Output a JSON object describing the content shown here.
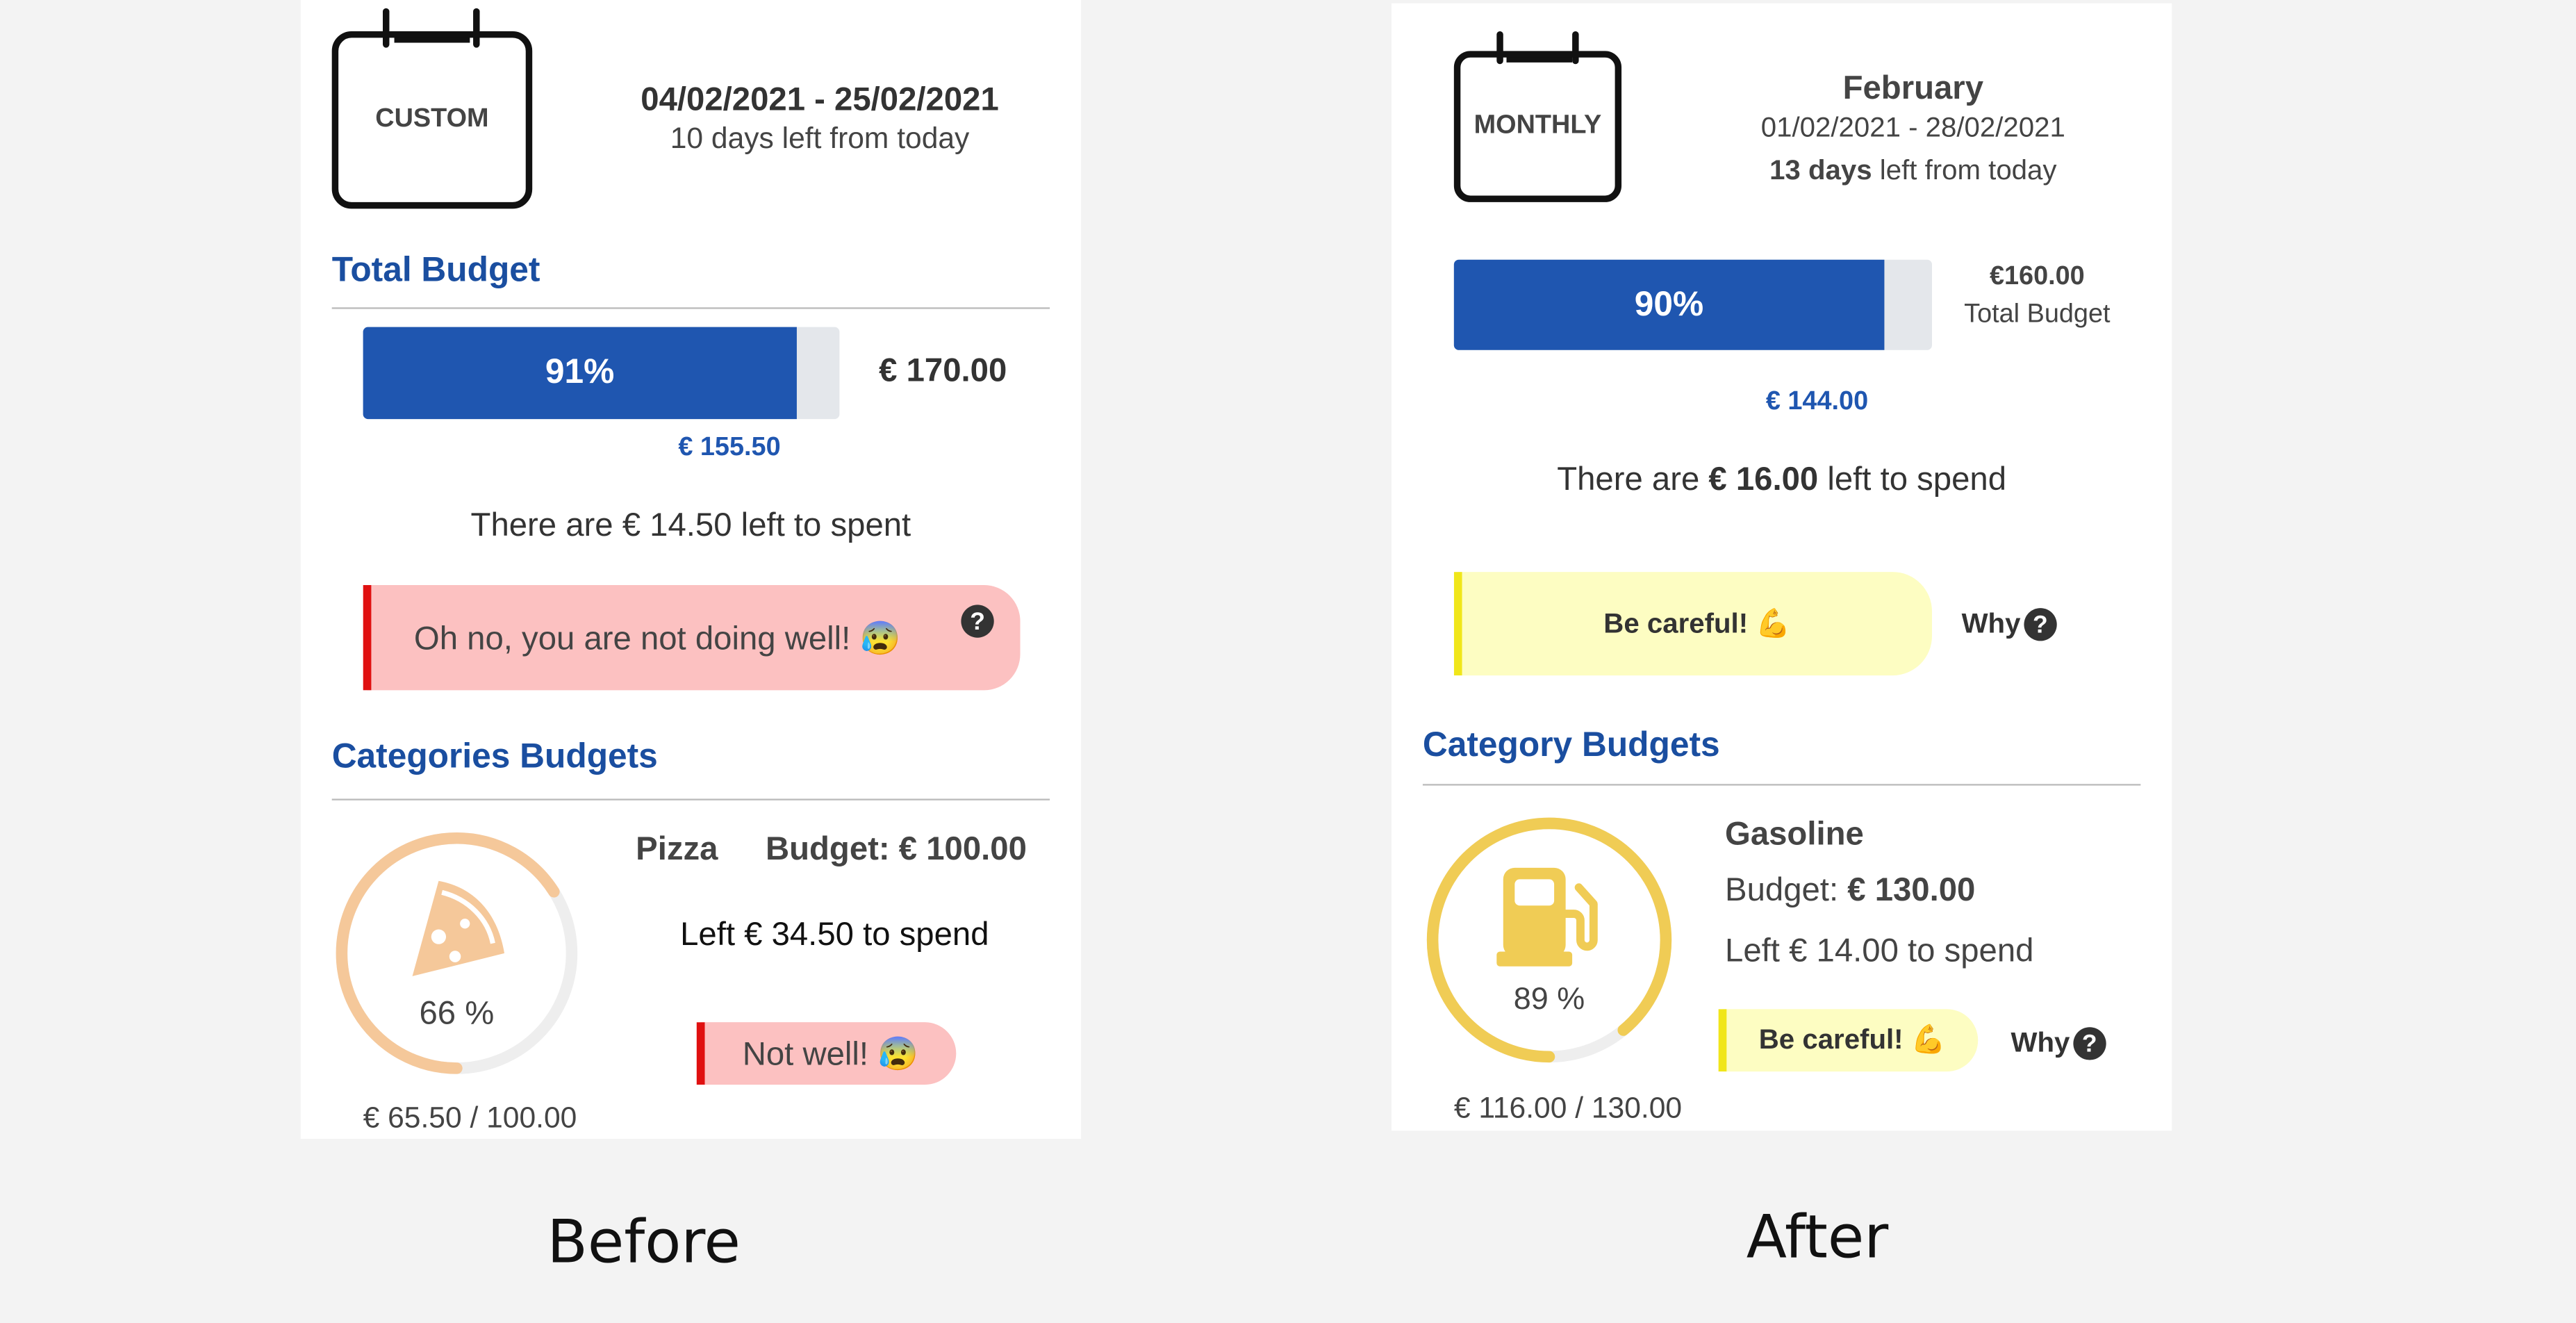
{
  "before": {
    "caption": "Before",
    "period_type": "CUSTOM",
    "date_range": "04/02/2021 - 25/02/2021",
    "days_left": "10 days left from today",
    "total_budget_title": "Total Budget",
    "progress_percent": 91,
    "progress_label": "91%",
    "total_amount": "€ 170.00",
    "spent_amount": "€ 155.50",
    "left_text": "There are € 14.50 left to spent",
    "alert_text": "Oh no, you are not doing well! 😰",
    "help_glyph": "?",
    "categories_title": "Categories Budgets",
    "category": {
      "name": "Pizza",
      "budget_label": "Budget: € 100.00",
      "left_text": "Left € 34.50 to spend",
      "percent": 66,
      "percent_label": "66 %",
      "amount_text": "€ 65.50 / 100.00",
      "status": "Not well! 😰",
      "icon": "pizza-icon",
      "color": "#f5c89a"
    },
    "colors": {
      "accent": "#1f56b0",
      "alert": "#e01010",
      "alert_bg": "#fcc1c1"
    }
  },
  "after": {
    "caption": "After",
    "period_type": "MONTHLY",
    "month": "February",
    "date_range": "01/02/2021 - 28/02/2021",
    "days_left_bold": "13 days",
    "days_left_rest": " left from today",
    "progress_percent": 90,
    "progress_label": "90%",
    "total_amount": "€160.00",
    "total_label": "Total Budget",
    "spent_amount": "€ 144.00",
    "left_prefix": "There are ",
    "left_amount": "€ 16.00",
    "left_suffix": " left to spend",
    "alert_text": "Be careful! 💪",
    "why_label": "Why",
    "help_glyph": "?",
    "categories_title": "Category Budgets",
    "category": {
      "name": "Gasoline",
      "budget_prefix": "Budget: ",
      "budget_amount": "€ 130.00",
      "left_text": "Left € 14.00 to spend",
      "percent": 89,
      "percent_label": "89 %",
      "amount_text": "€ 116.00 / 130.00",
      "status": "Be careful! 💪",
      "why_label": "Why",
      "icon": "gas-pump-icon",
      "color": "#f0cc55"
    },
    "colors": {
      "accent": "#1f56b0",
      "warning": "#f0e61a",
      "warning_bg": "#fdfdc2"
    }
  }
}
